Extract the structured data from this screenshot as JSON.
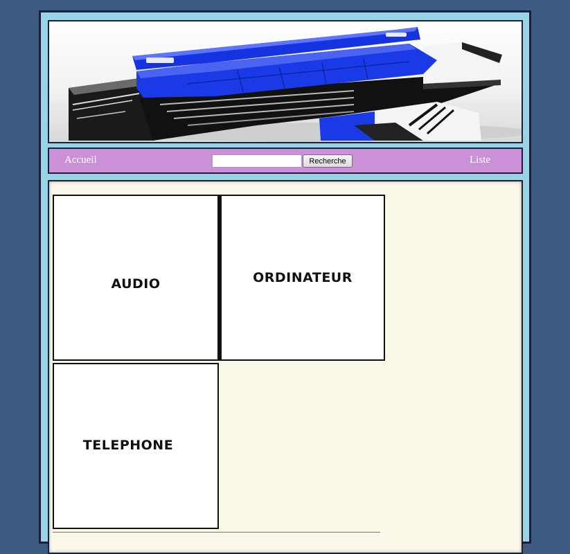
{
  "nav": {
    "home_label": "Accueil",
    "search_button_label": "Recherche",
    "search_value": "",
    "list_label": "Liste"
  },
  "categories": [
    {
      "label": "AUDIO"
    },
    {
      "label": "ORDINATEUR"
    },
    {
      "label": "TELEPHONE"
    }
  ],
  "colors": {
    "page_background": "#3d5a80",
    "frame": "#9ad2e6",
    "nav_background": "#cc90d8",
    "content_background": "#faf8e9",
    "sofa_blue": "#1a36e6"
  },
  "banner": {
    "image": "blue-modern-sofa-render"
  }
}
